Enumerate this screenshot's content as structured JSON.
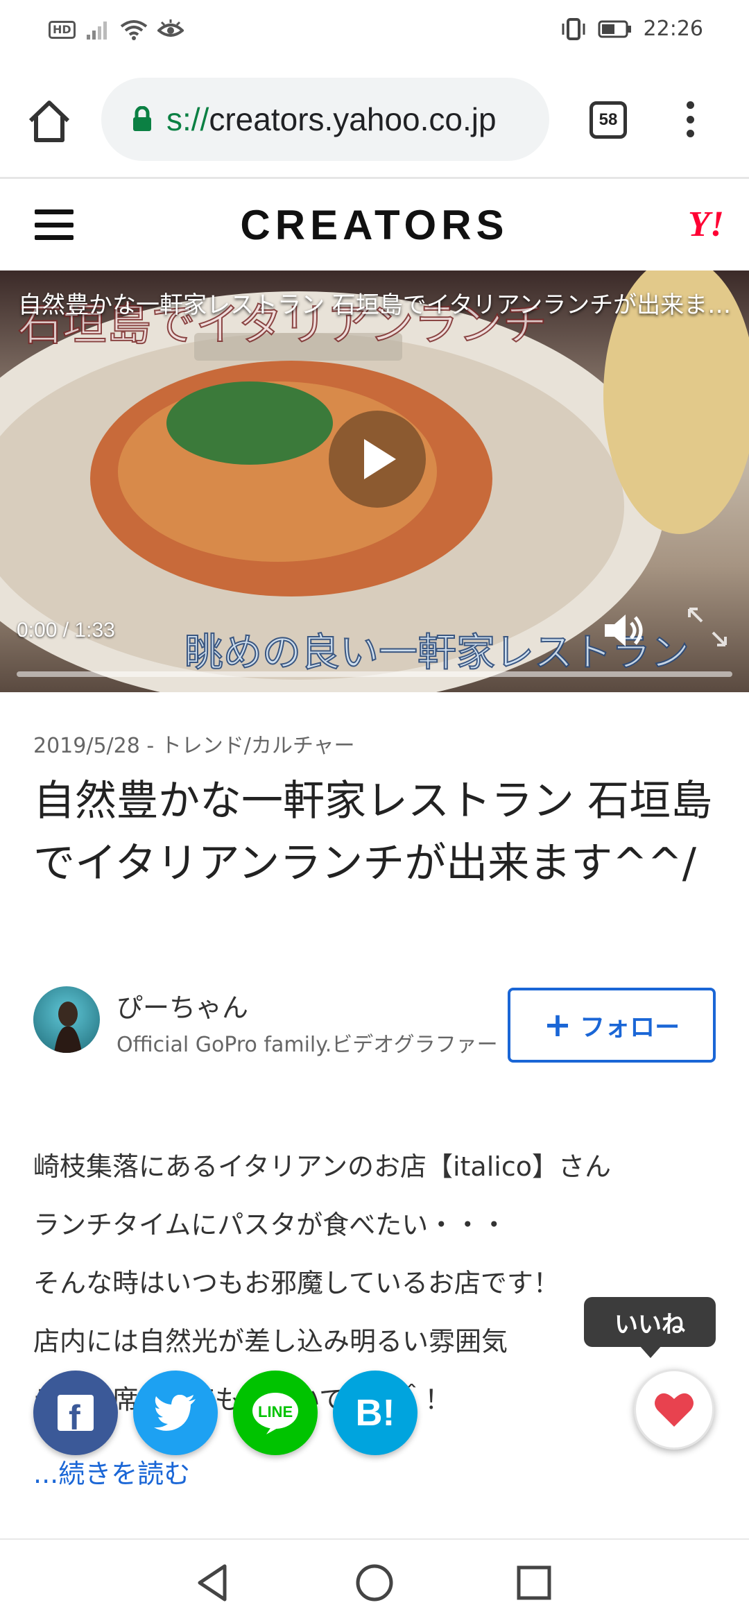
{
  "status_bar": {
    "hd_label": "HD",
    "time": "22:26"
  },
  "browser": {
    "url_scheme": "s://",
    "url_host": "creators.yahoo.co.jp",
    "tab_count": "58"
  },
  "header": {
    "brand": "CREATORS",
    "yahoo_logo": "Y!"
  },
  "video": {
    "title": "自然豊かな一軒家レストラン 石垣島でイタリアンランチが出来ます^^/",
    "current_time": "0:00",
    "separator": "/",
    "duration": "1:33",
    "progress": 0.0,
    "burned_in_top_text": "石垣島でイタリアンランチ",
    "burned_in_bottom_text": "眺めの良い一軒家レストラン"
  },
  "article": {
    "date": "2019/5/28",
    "meta_separator": "-",
    "category": "トレンド/カルチャー",
    "title": "自然豊かな一軒家レストラン 石垣島でイタリアンランチが出来ます^^/"
  },
  "author": {
    "name": "ぴーちゃん",
    "description": "Official GoPro family.ビデオグラファー",
    "follow_label": "フォロー"
  },
  "body": {
    "lines": [
      "崎枝集落にあるイタリアンのお店【italico】さん",
      "ランチタイムにパスタが食べたい・・・",
      "そんな時はいつもお邪魔しているお店です！",
      "店内には自然光が差し込み明るい雰囲気",
      "テラス席もとても可愛いです＾＾！"
    ],
    "read_more": "...続きを読む"
  },
  "share": {
    "facebook": "f",
    "twitter": "twitter-bird",
    "line": "LINE",
    "hatena": "B!"
  },
  "like": {
    "tooltip": "いいね"
  },
  "colors": {
    "accent_blue": "#1a66d6",
    "yahoo_red": "#ff0033",
    "facebook": "#3b5998",
    "twitter": "#1da1f2",
    "line": "#00c300",
    "hatena": "#00a4de",
    "like_heart": "#e8424f",
    "lock_green": "#0b8043"
  },
  "icons": {
    "status": [
      "hd-icon",
      "signal-icon",
      "wifi-icon",
      "eye-icon",
      "vibrate-icon",
      "battery-icon"
    ],
    "browser": [
      "home-icon",
      "lock-icon",
      "tabs-icon",
      "more-vert-icon"
    ],
    "nav": [
      "back-icon",
      "home-circle-icon",
      "recents-icon"
    ]
  }
}
